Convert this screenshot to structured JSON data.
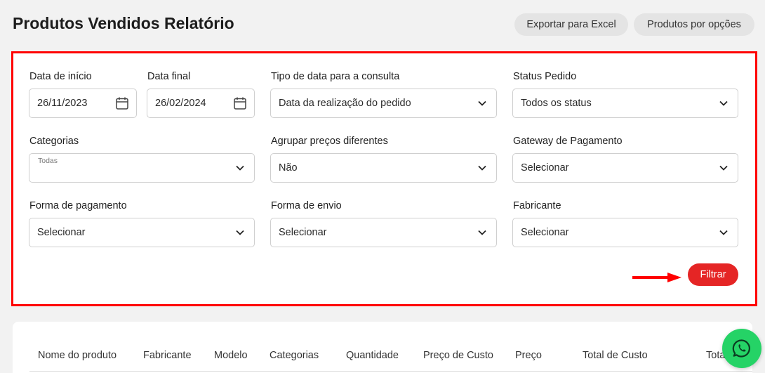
{
  "header": {
    "title": "Produtos Vendidos Relatório",
    "export_label": "Exportar para Excel",
    "options_label": "Produtos por opções"
  },
  "filters": {
    "start_date": {
      "label": "Data de início",
      "value": "26/11/2023"
    },
    "end_date": {
      "label": "Data final",
      "value": "26/02/2024"
    },
    "date_type": {
      "label": "Tipo de data para a consulta",
      "value": "Data da realização do pedido"
    },
    "order_status": {
      "label": "Status Pedido",
      "value": "Todos os status"
    },
    "categories": {
      "label": "Categorias",
      "value": "Todas"
    },
    "group_prices": {
      "label": "Agrupar preços diferentes",
      "value": "Não"
    },
    "gateway": {
      "label": "Gateway de Pagamento",
      "value": "Selecionar"
    },
    "payment_method": {
      "label": "Forma de pagamento",
      "value": "Selecionar"
    },
    "shipping_method": {
      "label": "Forma de envio",
      "value": "Selecionar"
    },
    "manufacturer": {
      "label": "Fabricante",
      "value": "Selecionar"
    },
    "filter_label": "Filtrar"
  },
  "table": {
    "columns": [
      "Nome do produto",
      "Fabricante",
      "Modelo",
      "Categorias",
      "Quantidade",
      "Preço de Custo",
      "Preço",
      "Total de Custo",
      "Total"
    ]
  },
  "colors": {
    "accent": "#e52525",
    "highlight_border": "#ff0000",
    "whatsapp": "#25d366"
  },
  "icons": {
    "calendar": "calendar-icon",
    "chevron": "chevron-down-icon",
    "whatsapp": "whatsapp-icon",
    "arrow": "arrow-right-icon"
  }
}
